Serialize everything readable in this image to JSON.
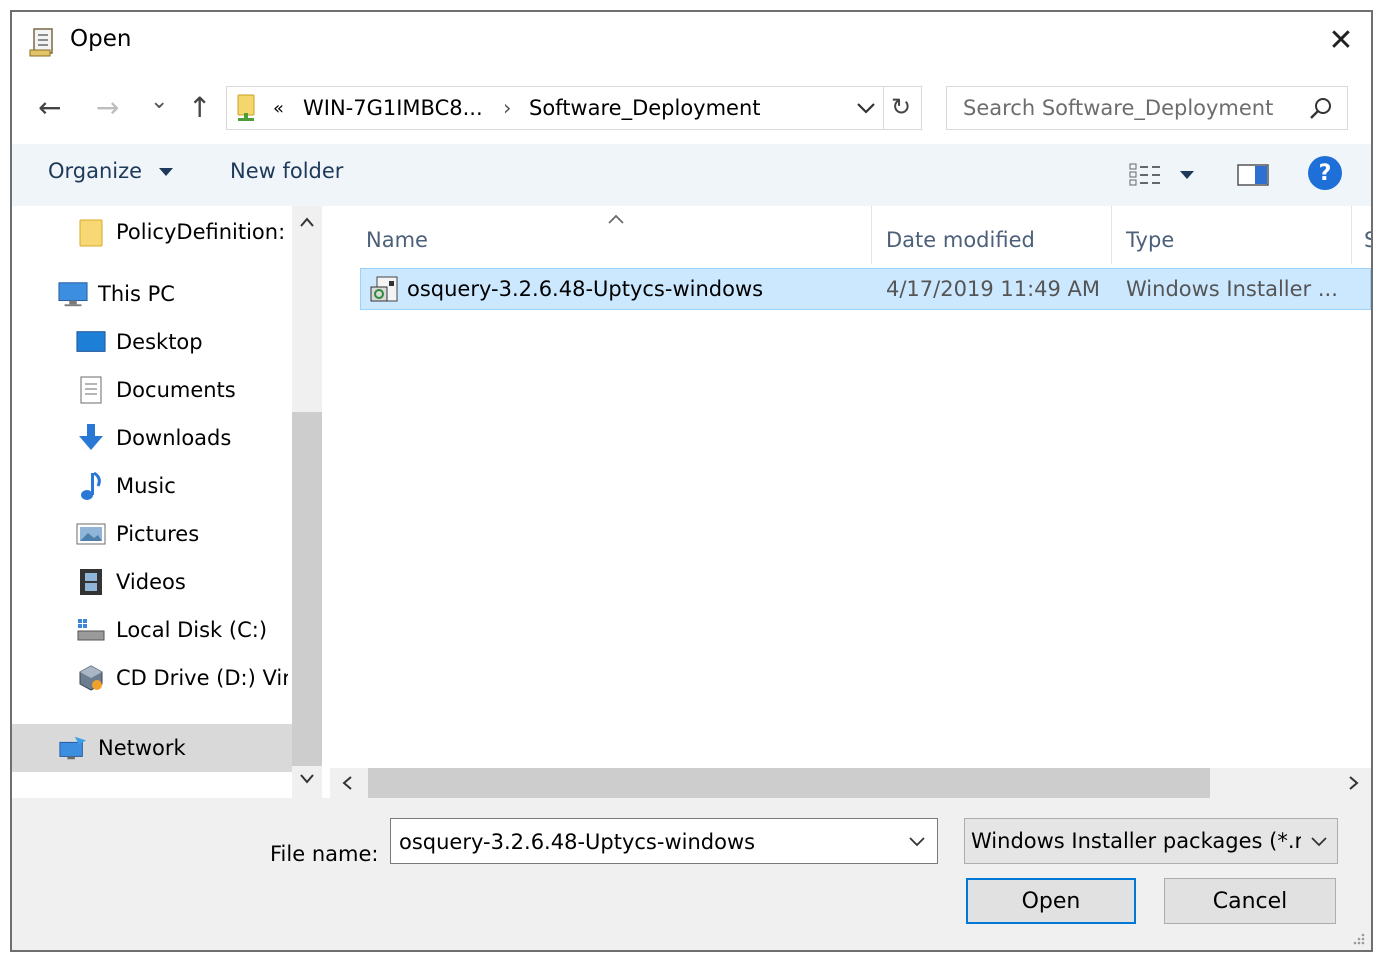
{
  "window": {
    "title": "Open",
    "close_glyph": "✕"
  },
  "nav": {
    "back_glyph": "←",
    "forward_glyph": "→",
    "dropdown_glyph": "⌄",
    "up_glyph": "↑"
  },
  "address": {
    "chevron": "«",
    "segments": [
      "WIN-7G1IMBC8...",
      "Software_Deployment"
    ],
    "separator": "›",
    "refresh_glyph": "↻"
  },
  "search": {
    "placeholder": "Search Software_Deployment"
  },
  "toolbar": {
    "organize_label": "Organize",
    "new_folder_label": "New folder",
    "help_glyph": "?"
  },
  "sidebar": {
    "items": [
      {
        "label": "PolicyDefinition:",
        "icon": "folder-icon"
      },
      {
        "label": "This PC",
        "icon": "computer-icon"
      },
      {
        "label": "Desktop",
        "icon": "desktop-icon"
      },
      {
        "label": "Documents",
        "icon": "documents-icon"
      },
      {
        "label": "Downloads",
        "icon": "downloads-icon"
      },
      {
        "label": "Music",
        "icon": "music-icon"
      },
      {
        "label": "Pictures",
        "icon": "pictures-icon"
      },
      {
        "label": "Videos",
        "icon": "videos-icon"
      },
      {
        "label": "Local Disk (C:)",
        "icon": "drive-icon"
      },
      {
        "label": "CD Drive (D:) Vir",
        "icon": "cd-drive-icon"
      },
      {
        "label": "Network",
        "icon": "network-icon"
      }
    ]
  },
  "file_list": {
    "columns": [
      "Name",
      "Date modified",
      "Type",
      "S"
    ],
    "rows": [
      {
        "name": "osquery-3.2.6.48-Uptycs-windows",
        "date": "4/17/2019 11:49 AM",
        "type": "Windows Installer ..."
      }
    ]
  },
  "footer": {
    "file_name_label": "File name:",
    "file_name_value": "osquery-3.2.6.48-Uptycs-windows",
    "file_type_value": "Windows Installer packages (*.r",
    "open_label": "Open",
    "cancel_label": "Cancel"
  },
  "colors": {
    "accent": "#0078d7",
    "selection": "#cce8ff",
    "help": "#1e6fd8"
  }
}
